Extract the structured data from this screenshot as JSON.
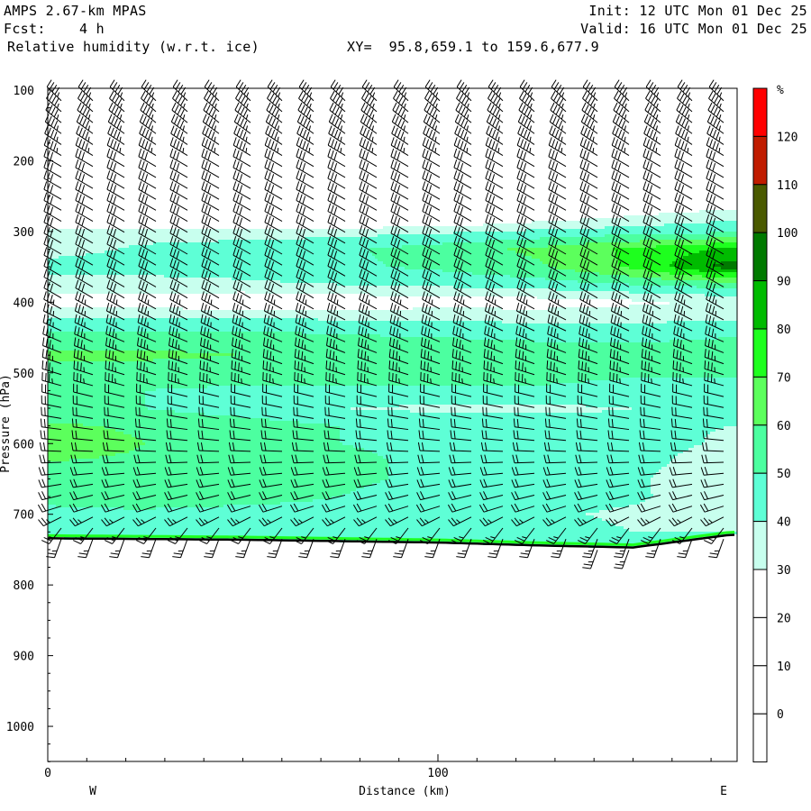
{
  "header": {
    "model": "AMPS 2.67-km MPAS",
    "init": "Init: 12 UTC Mon 01 Dec 25",
    "fcst": "Fcst:    4 h",
    "valid": "Valid: 16 UTC Mon 01 Dec 25",
    "field": "Relative humidity (w.r.t. ice)",
    "xy": "XY=  95.8,659.1 to 159.6,677.9"
  },
  "chart_data": {
    "type": "heatmap",
    "title": "Relative humidity (w.r.t. ice)",
    "xlabel": "Distance (km)",
    "ylabel": "Pressure (hPa)",
    "xlim": [
      0,
      176.6
    ],
    "ylim": [
      1050,
      100
    ],
    "x_ticks": [
      0,
      100
    ],
    "y_ticks": [
      100,
      200,
      300,
      400,
      500,
      600,
      700,
      800,
      900,
      1000
    ],
    "left_label": "W",
    "right_label": "E",
    "colorbar": {
      "unit": "%",
      "levels": [
        120,
        110,
        100,
        90,
        80,
        70,
        60,
        50,
        40,
        30,
        20,
        10,
        0
      ],
      "colors": [
        "#ff0000",
        "#c01c00",
        "#4a5a00",
        "#007a00",
        "#00bb00",
        "#1eff1e",
        "#5cff5c",
        "#4cffa0",
        "#5effd6",
        "#c8ffee",
        "#ffffff",
        "#ffffff",
        "#ffffff",
        "#ffffff"
      ]
    },
    "rh_grid": {
      "distance_km": [
        0,
        25,
        50,
        75,
        100,
        125,
        150,
        175
      ],
      "pressure_hpa": [
        250,
        275,
        300,
        325,
        350,
        375,
        400,
        425,
        450,
        475,
        500,
        525,
        550,
        575,
        600,
        625,
        650,
        675,
        700,
        725
      ],
      "values": [
        [
          5,
          5,
          5,
          5,
          5,
          5,
          10,
          15
        ],
        [
          5,
          5,
          5,
          5,
          8,
          20,
          28,
          35
        ],
        [
          35,
          35,
          35,
          36,
          38,
          42,
          45,
          48
        ],
        [
          35,
          42,
          45,
          48,
          55,
          62,
          72,
          82
        ],
        [
          45,
          45,
          45,
          48,
          52,
          58,
          72,
          95
        ],
        [
          35,
          35,
          38,
          40,
          42,
          45,
          50,
          55
        ],
        [
          25,
          25,
          20,
          22,
          25,
          25,
          28,
          32
        ],
        [
          42,
          42,
          42,
          40,
          40,
          38,
          38,
          40
        ],
        [
          55,
          55,
          55,
          52,
          50,
          48,
          48,
          50
        ],
        [
          62,
          62,
          60,
          60,
          60,
          58,
          55,
          55
        ],
        [
          55,
          55,
          55,
          55,
          55,
          55,
          52,
          52
        ],
        [
          50,
          50,
          48,
          48,
          48,
          48,
          45,
          45
        ],
        [
          52,
          50,
          45,
          40,
          38,
          38,
          40,
          45
        ],
        [
          62,
          58,
          55,
          50,
          45,
          45,
          42,
          40
        ],
        [
          68,
          60,
          55,
          50,
          48,
          45,
          45,
          38
        ],
        [
          60,
          58,
          55,
          52,
          48,
          45,
          45,
          32
        ],
        [
          55,
          55,
          55,
          52,
          48,
          45,
          42,
          30
        ],
        [
          52,
          55,
          55,
          50,
          45,
          45,
          42,
          32
        ],
        [
          48,
          48,
          45,
          45,
          45,
          42,
          38,
          35
        ],
        [
          48,
          48,
          45,
          45,
          45,
          45,
          40,
          40
        ]
      ]
    },
    "surface_pressure_hpa": [
      734,
      735,
      736,
      738,
      740,
      744,
      747,
      729
    ],
    "wind_profile": [
      {
        "p": 110,
        "dir": 315,
        "spd": 35
      },
      {
        "p": 200,
        "dir": 300,
        "spd": 35
      },
      {
        "p": 400,
        "dir": 300,
        "spd": 30
      },
      {
        "p": 520,
        "dir": 285,
        "spd": 25
      },
      {
        "p": 600,
        "dir": 275,
        "spd": 20
      },
      {
        "p": 700,
        "dir": 250,
        "spd": 20
      },
      {
        "p": 730,
        "dir": 200,
        "spd": 15
      }
    ]
  }
}
